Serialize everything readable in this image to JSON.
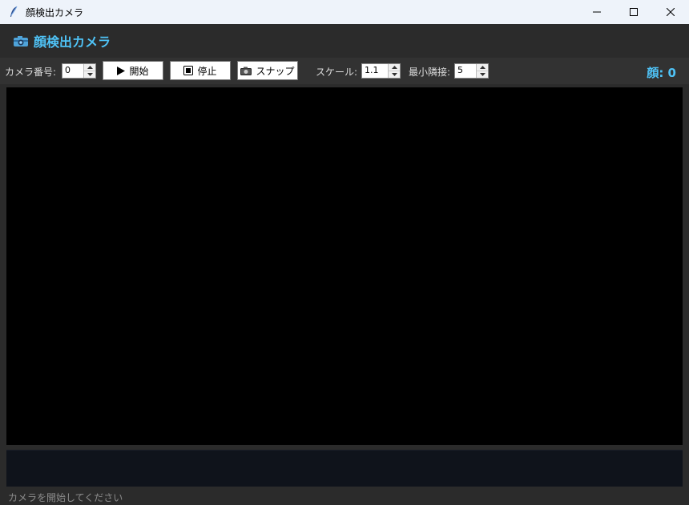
{
  "window": {
    "title": "顔検出カメラ",
    "controls": [
      "minimize-icon",
      "maximize-icon",
      "close-icon"
    ]
  },
  "header": {
    "icon": "camera-icon",
    "title": "顔検出カメラ"
  },
  "toolbar": {
    "camera_label": "カメラ番号:",
    "camera_value": "0",
    "start_label": "開始",
    "stop_label": "停止",
    "snap_label": "スナップ",
    "scale_label": "スケール:",
    "scale_value": "1.1",
    "min_neighbors_label": "最小隣接:",
    "min_neighbors_value": "5",
    "face_count": "顔: 0"
  },
  "status": {
    "text": "カメラを開始してください"
  },
  "colors": {
    "accent": "#4fc3f7",
    "background": "#2b2b2b",
    "toolbar": "#323232",
    "video": "#000000",
    "log": "#0f131b"
  }
}
